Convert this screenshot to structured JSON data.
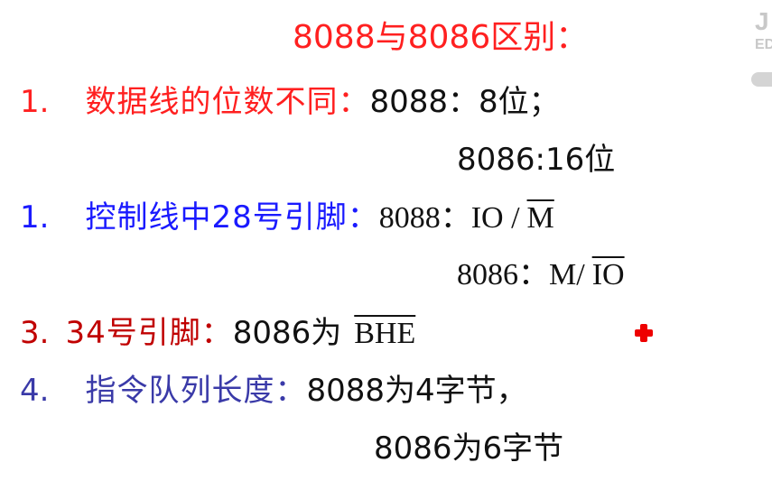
{
  "title": "8088与8086区别：",
  "items": [
    {
      "num": "1.",
      "label": "数据线的位数不同：",
      "v1": "8088：8位；",
      "v2": "8086:16位"
    },
    {
      "num": "1.",
      "label": "控制线中28号引脚：",
      "v1_pre": "8088：IO /",
      "v1_ov": "M",
      "v2_pre": "8086：M/",
      "v2_ov": "IO"
    },
    {
      "num": "3.",
      "label": "34号引脚：",
      "v1_pre": "8086为",
      "v1_ov": "BHE"
    },
    {
      "num": "4.",
      "label": "指令队列长度：",
      "v1": "8088为4字节，",
      "v2": "8086为6字节"
    }
  ],
  "watermark": {
    "top": "J",
    "bottom": "ED"
  },
  "colors": {
    "title": "#ff2020",
    "item1": "#ff2020",
    "item2": "#1a1aff",
    "item3": "#c00000",
    "item4": "#3a3aa8",
    "marker": "#ee0000"
  }
}
